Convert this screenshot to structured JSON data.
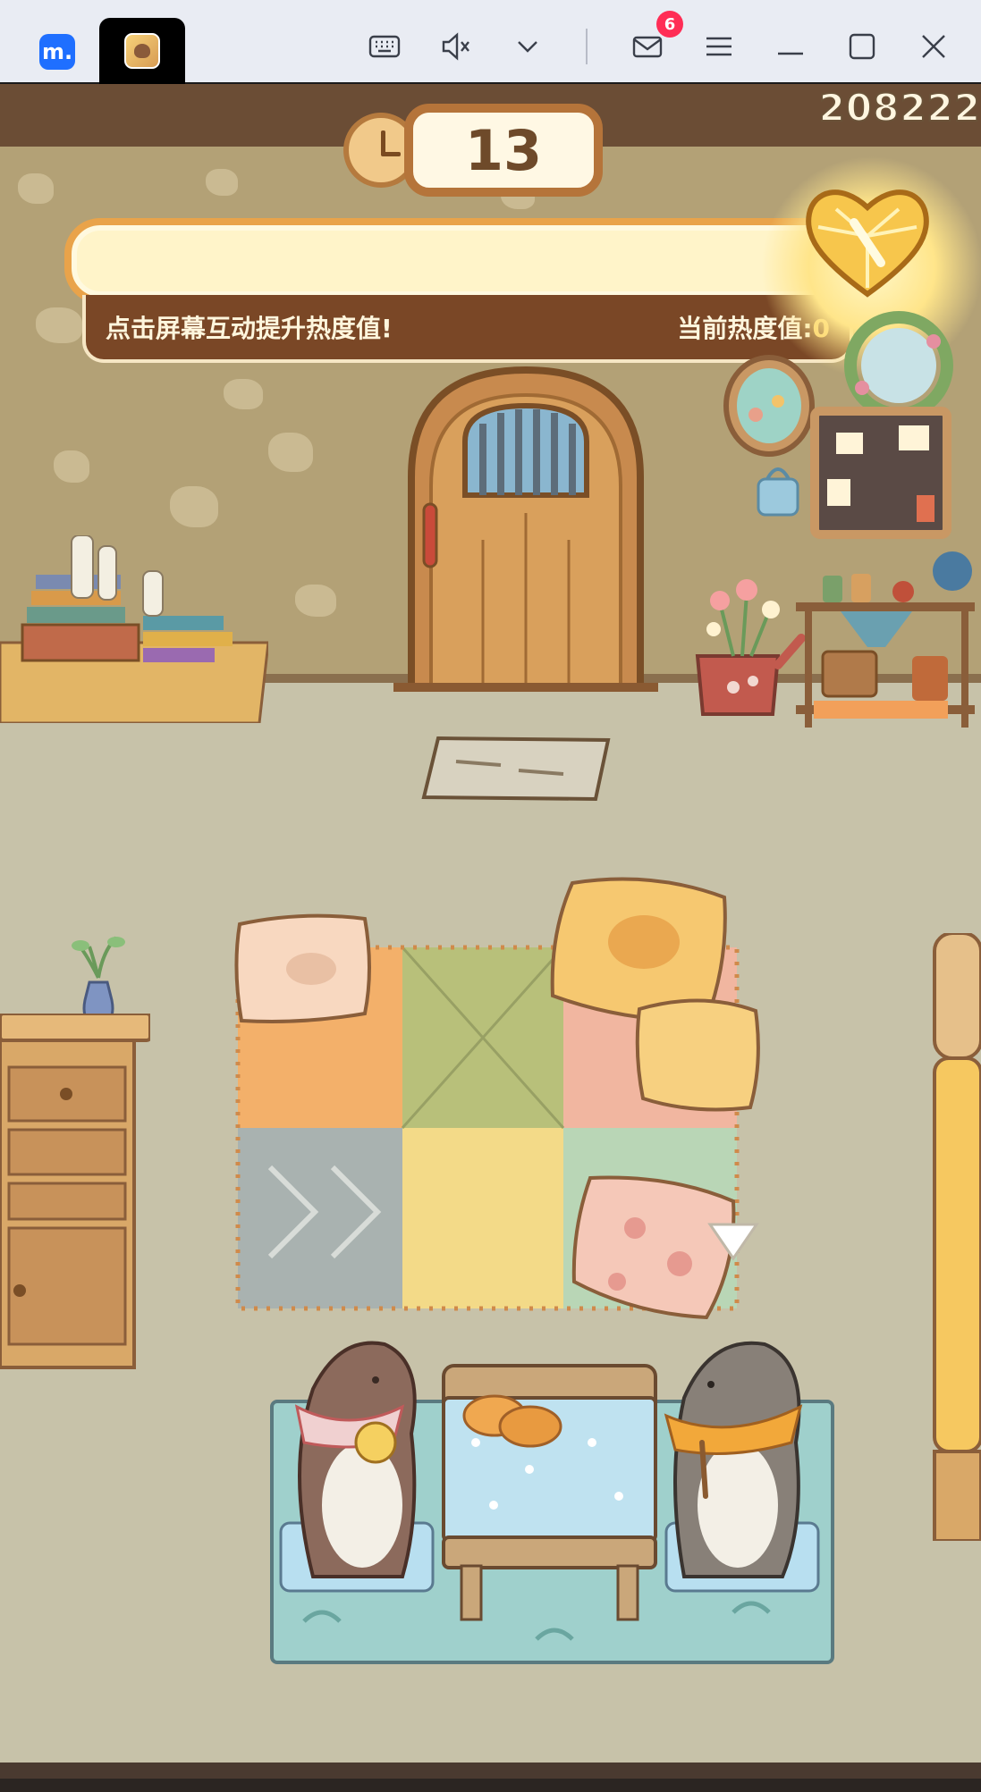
{
  "window": {
    "app_logo": "m.",
    "mail_badge": "6",
    "icons": [
      "keyboard-icon",
      "mute-icon",
      "chevron-down-icon",
      "mail-icon",
      "menu-icon",
      "minimize-icon",
      "maximize-icon",
      "close-icon"
    ]
  },
  "game": {
    "timer": "13",
    "corner_code": "208222",
    "heat_hint": "点击屏幕互动提升热度值!",
    "heat_label": "当前热度值:",
    "heat_value": "0",
    "heat_level": 0
  },
  "colors": {
    "wall": "#b3a176",
    "floor": "#c7c2a9",
    "accent": "#e9a34a",
    "panel": "#7a4726"
  }
}
